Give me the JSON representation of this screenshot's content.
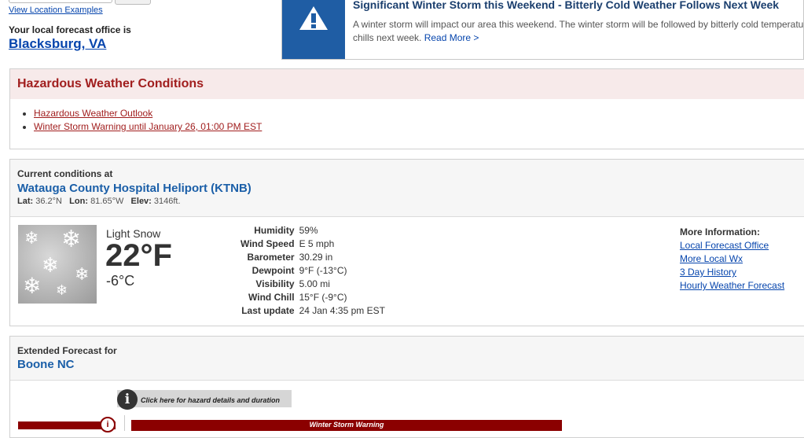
{
  "location": {
    "examples_link": "View Location Examples",
    "office_label": "Your local forecast office is",
    "office_name": "Blacksburg, VA"
  },
  "banner": {
    "title": "Significant Winter Storm this Weekend - Bitterly Cold Weather Follows Next Week",
    "text_line1": "A winter storm will impact our area this weekend. The winter storm will be followed by bitterly cold temperatu",
    "text_line2": "chills next week.",
    "read_more": "Read More >"
  },
  "hazards": {
    "title": "Hazardous Weather Conditions",
    "items": [
      "Hazardous Weather Outlook",
      "Winter Storm Warning until January 26, 01:00 PM EST"
    ]
  },
  "current": {
    "label": "Current conditions at",
    "station": "Watauga County Hospital Heliport (KTNB)",
    "lat_label": "Lat:",
    "lat": "36.2°N",
    "lon_label": "Lon:",
    "lon": "81.65°W",
    "elev_label": "Elev:",
    "elev": "3146ft.",
    "condition": "Light Snow",
    "temp_f": "22°F",
    "temp_c": "-6°C",
    "details": [
      {
        "label": "Humidity",
        "value": "59%"
      },
      {
        "label": "Wind Speed",
        "value": "E 5 mph"
      },
      {
        "label": "Barometer",
        "value": "30.29 in"
      },
      {
        "label": "Dewpoint",
        "value": "9°F (-13°C)"
      },
      {
        "label": "Visibility",
        "value": "5.00 mi"
      },
      {
        "label": "Wind Chill",
        "value": "15°F (-9°C)"
      },
      {
        "label": "Last update",
        "value": "24 Jan 4:35 pm EST"
      }
    ],
    "more_info": {
      "heading": "More Information:",
      "links": [
        "Local Forecast Office",
        "More Local Wx",
        "3 Day History",
        "Hourly Weather Forecast"
      ]
    }
  },
  "extended": {
    "label": "Extended Forecast for",
    "place": "Boone NC",
    "hazard_hint": "Click here for hazard details and duration",
    "warning_band": "Winter Storm Warning"
  },
  "colors": {
    "link": "#0645ad",
    "hazard_red": "#a11e1e",
    "banner_blue": "#1f5da4",
    "warning_band": "#8b0000"
  },
  "icons": {
    "banner": "alert-triangle-icon",
    "hazard_info": "info-icon"
  }
}
